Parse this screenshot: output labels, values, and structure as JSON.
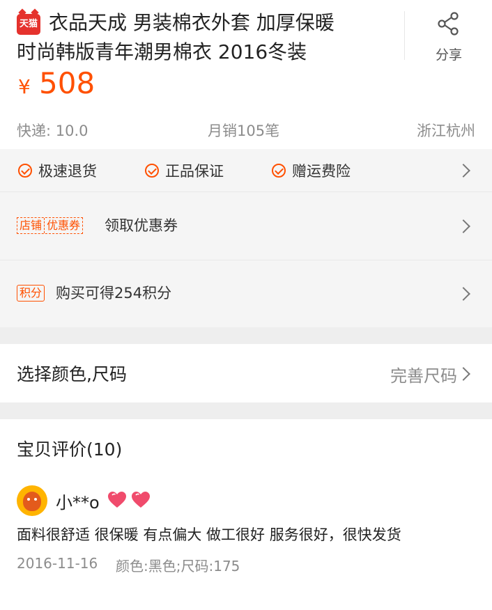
{
  "product": {
    "badge": "天猫",
    "title_line1": "衣品天成 男装棉衣外套 加厚保暖",
    "title_line2": "时尚韩版青年潮男棉衣 2016冬装",
    "share_label": "分享",
    "price_symbol": "¥",
    "price": "508",
    "shipping": "快递: 10.0",
    "monthly_sales": "月销105笔",
    "location": "浙江杭州"
  },
  "services": {
    "items": [
      "极速退货",
      "正品保证",
      "赠运费险"
    ],
    "coupon_tag_left": "店铺",
    "coupon_tag_right": "优惠券",
    "coupon_text": "领取优惠券",
    "points_tag": "积分",
    "points_text": "购买可得254积分"
  },
  "sku": {
    "label": "选择颜色,尺码",
    "action": "完善尺码"
  },
  "reviews": {
    "title": "宝贝评价(10)",
    "items": [
      {
        "user": "小**o",
        "text": "面料很舒适 很保暖 有点偏大 做工很好 服务很好，很快发货",
        "date": "2016-11-16",
        "sku": "颜色:黑色;尺码:175"
      }
    ]
  },
  "colors": {
    "accent": "#ff5000",
    "tmall_red": "#e5322d",
    "heart": "#f04b6c"
  },
  "icons": [
    "tmall-badge-icon",
    "share-icon",
    "check-circle-icon",
    "chevron-right-icon",
    "heart-icon"
  ]
}
